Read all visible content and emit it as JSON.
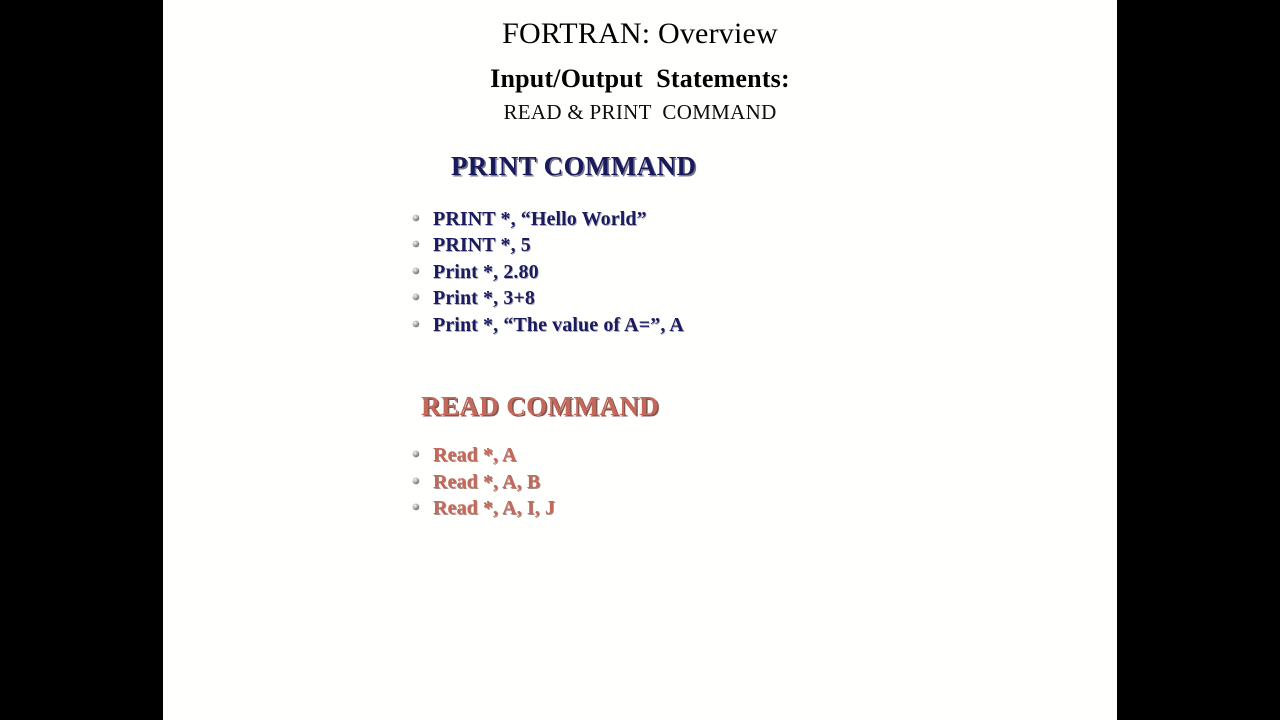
{
  "slide": {
    "background_color": "#fffffe",
    "letterbox_color": "#000000",
    "title": {
      "main": "FORTRAN: Overview",
      "sub": "Input/Output  Statements:",
      "sub2": "READ & PRINT  COMMAND"
    },
    "sections": [
      {
        "id": "print",
        "heading": "PRINT COMMAND",
        "heading_color": "#191a5e",
        "text_color": "#1b1b60",
        "bullet_icon": "sphere-bullet-icon",
        "items": [
          "PRINT *, “Hello World”",
          "PRINT *, 5",
          "Print *, 2.80",
          "Print *, 3+8",
          "Print *, “The value of A=”, A"
        ]
      },
      {
        "id": "read",
        "heading": "READ COMMAND",
        "heading_color": "#c4685a",
        "text_color": "#c4685a",
        "bullet_icon": "sphere-bullet-icon",
        "items": [
          "Read *, A",
          "Read *, A, B",
          "Read *, A, I, J"
        ]
      }
    ]
  }
}
